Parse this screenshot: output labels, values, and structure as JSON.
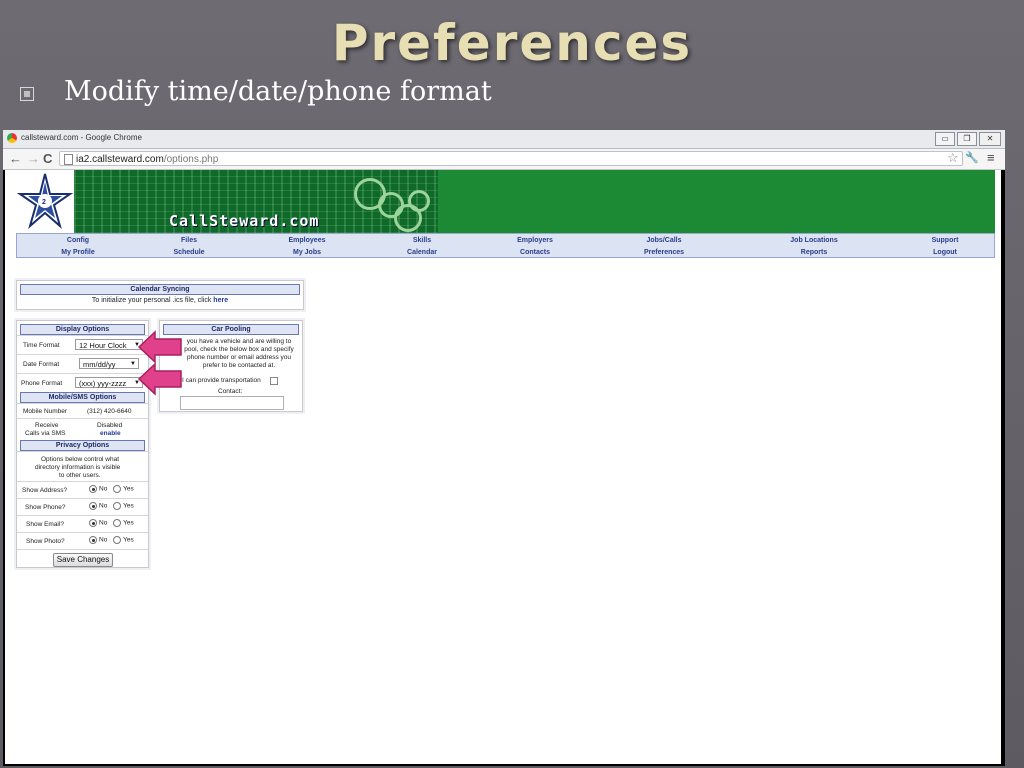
{
  "slide": {
    "title": "Preferences",
    "bullet": "Modify time/date/phone format"
  },
  "browser": {
    "window_title": "callsteward.com - Google Chrome",
    "url_host": "ia2.callsteward.com",
    "url_path": "/options.php",
    "window_buttons": [
      "▭",
      "❐",
      "✕"
    ]
  },
  "site": {
    "brand": "CallSteward.com",
    "nav_top": [
      "Config",
      "Files",
      "Employees",
      "Skills",
      "Employers",
      "Jobs/Calls",
      "Job Locations",
      "Support"
    ],
    "nav_bottom": [
      "My Profile",
      "Schedule",
      "My Jobs",
      "Calendar",
      "Contacts",
      "Preferences",
      "Reports",
      "Logout"
    ]
  },
  "calendar": {
    "header": "Calendar Syncing",
    "text": "To initialize your personal .ics file, click",
    "link": "here"
  },
  "display": {
    "header": "Display Options",
    "time_label": "Time Format",
    "time_value": "12 Hour Clock",
    "date_label": "Date Format",
    "date_value": "mm/dd/yy",
    "phone_label": "Phone Format",
    "phone_value": "(xxx) yyy-zzzz"
  },
  "mobile": {
    "header": "Mobile/SMS Options",
    "number_label": "Mobile Number",
    "number_value": "(312) 420-6640",
    "receive_label_1": "Receive",
    "receive_label_2": "Calls via SMS",
    "status": "Disabled",
    "enable_link": "enable"
  },
  "privacy": {
    "header": "Privacy Options",
    "desc_1": "Options below control what",
    "desc_2": "directory information is visible",
    "desc_3": "to other users.",
    "no_label": "No",
    "yes_label": "Yes",
    "rows": [
      {
        "label": "Show Address?"
      },
      {
        "label": "Show Phone?"
      },
      {
        "label": "Show Email?"
      },
      {
        "label": "Show Photo?"
      }
    ],
    "save_button": "Save Changes"
  },
  "carpool": {
    "header": "Car Pooling",
    "line1": "you have a vehicle and are willing to",
    "line2": "pool, check the below box and specify",
    "line3": "phone number or email address you",
    "line4": "prefer to be contacted at.",
    "checkbox_label": "I can provide transportation",
    "contact_label": "Contact:"
  },
  "colors": {
    "arrow": "#e0418a",
    "banner": "#1c8a35",
    "nav_text": "#2b3d8c"
  }
}
